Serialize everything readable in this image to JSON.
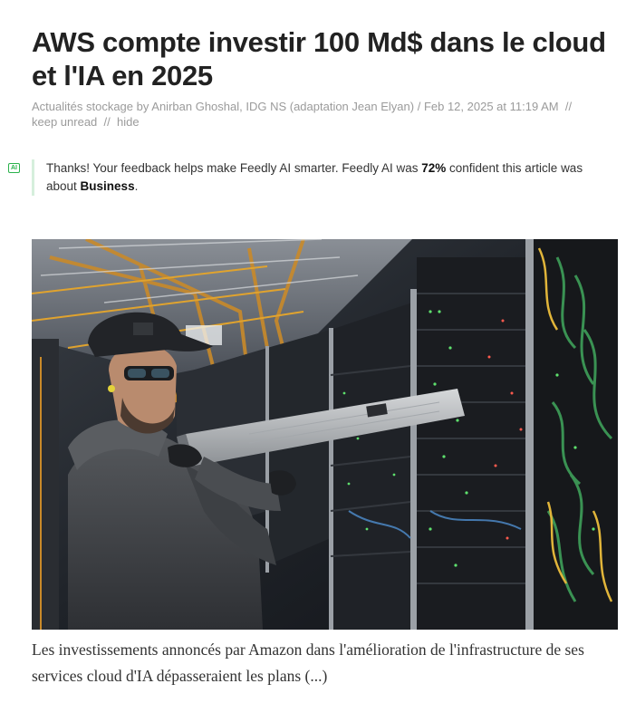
{
  "article": {
    "title": "AWS compte investir 100 Md$ dans le cloud et l'IA en 2025",
    "meta": {
      "source": "Actualités stockage",
      "by_word": "by",
      "author": "Anirban Ghoshal, IDG NS (adaptation Jean Elyan)",
      "date_sep": "/",
      "date": "Feb 12, 2025 at 11:19 AM",
      "sep1": "//",
      "keep_unread": "keep unread",
      "sep2": "//",
      "hide": "hide"
    },
    "ai_badge": "AI",
    "feedback": {
      "part1": "Thanks! Your feedback helps make Feedly AI smarter. Feedly AI was ",
      "confidence": "72%",
      "part2": " confident this article was about ",
      "topic": "Business",
      "part3": "."
    },
    "hero_image": {
      "icon": "datacenter-technician-photo"
    },
    "summary": "Les investissements annoncés par Amazon dans l'amélioration de l'infrastructure de ses services cloud d'IA dépasseraient les plans (...)"
  },
  "colors": {
    "accent_green": "#2bb24c",
    "feedback_border": "#d6efdc",
    "meta_gray": "#9b9b9b"
  }
}
